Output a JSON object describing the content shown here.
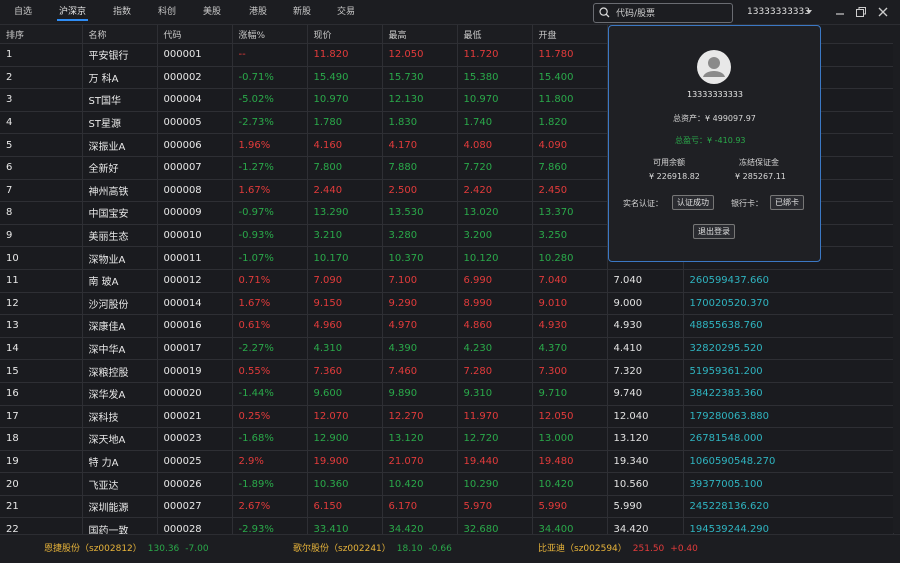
{
  "tabs": [
    "自选",
    "沪深京",
    "指数",
    "科创",
    "美股",
    "港股",
    "新股",
    "交易"
  ],
  "active_tab": 1,
  "search": {
    "placeholder": "代码/股票"
  },
  "user": {
    "account": "13333333333"
  },
  "columns": [
    "排序",
    "名称",
    "代码",
    "涨幅%",
    "现价",
    "最高",
    "最低",
    "开盘",
    "",
    ""
  ],
  "rows": [
    {
      "rank": "1",
      "name": "平安银行",
      "code": "000001",
      "chg": "--",
      "price": "11.820",
      "high": "12.050",
      "low": "11.720",
      "open": "11.780",
      "prev": "",
      "amount": "",
      "dir": "flat"
    },
    {
      "rank": "2",
      "name": "万 科A",
      "code": "000002",
      "chg": "-0.71%",
      "price": "15.490",
      "high": "15.730",
      "low": "15.380",
      "open": "15.400",
      "prev": "",
      "amount": "",
      "dir": "dn"
    },
    {
      "rank": "3",
      "name": "ST国华",
      "code": "000004",
      "chg": "-5.02%",
      "price": "10.970",
      "high": "12.130",
      "low": "10.970",
      "open": "11.800",
      "prev": "",
      "amount": "",
      "dir": "dn"
    },
    {
      "rank": "4",
      "name": "ST星源",
      "code": "000005",
      "chg": "-2.73%",
      "price": "1.780",
      "high": "1.830",
      "low": "1.740",
      "open": "1.820",
      "prev": "",
      "amount": "",
      "dir": "dn"
    },
    {
      "rank": "5",
      "name": "深振业A",
      "code": "000006",
      "chg": "1.96%",
      "price": "4.160",
      "high": "4.170",
      "low": "4.080",
      "open": "4.090",
      "prev": "",
      "amount": "",
      "dir": "up"
    },
    {
      "rank": "6",
      "name": "全新好",
      "code": "000007",
      "chg": "-1.27%",
      "price": "7.800",
      "high": "7.880",
      "low": "7.720",
      "open": "7.860",
      "prev": "",
      "amount": "",
      "dir": "dn"
    },
    {
      "rank": "7",
      "name": "神州高铁",
      "code": "000008",
      "chg": "1.67%",
      "price": "2.440",
      "high": "2.500",
      "low": "2.420",
      "open": "2.450",
      "prev": "",
      "amount": "",
      "dir": "up"
    },
    {
      "rank": "8",
      "name": "中国宝安",
      "code": "000009",
      "chg": "-0.97%",
      "price": "13.290",
      "high": "13.530",
      "low": "13.020",
      "open": "13.370",
      "prev": "",
      "amount": "",
      "dir": "dn"
    },
    {
      "rank": "9",
      "name": "美丽生态",
      "code": "000010",
      "chg": "-0.93%",
      "price": "3.210",
      "high": "3.280",
      "low": "3.200",
      "open": "3.250",
      "prev": "",
      "amount": "",
      "dir": "dn"
    },
    {
      "rank": "10",
      "name": "深物业A",
      "code": "000011",
      "chg": "-1.07%",
      "price": "10.170",
      "high": "10.370",
      "low": "10.120",
      "open": "10.280",
      "prev": "",
      "amount": "",
      "dir": "dn"
    },
    {
      "rank": "11",
      "name": "南 玻A",
      "code": "000012",
      "chg": "0.71%",
      "price": "7.090",
      "high": "7.100",
      "low": "6.990",
      "open": "7.040",
      "prev": "7.040",
      "amount": "260599437.660",
      "dir": "up"
    },
    {
      "rank": "12",
      "name": "沙河股份",
      "code": "000014",
      "chg": "1.67%",
      "price": "9.150",
      "high": "9.290",
      "low": "8.990",
      "open": "9.010",
      "prev": "9.000",
      "amount": "170020520.370",
      "dir": "up"
    },
    {
      "rank": "13",
      "name": "深康佳A",
      "code": "000016",
      "chg": "0.61%",
      "price": "4.960",
      "high": "4.970",
      "low": "4.860",
      "open": "4.930",
      "prev": "4.930",
      "amount": "48855638.760",
      "dir": "up"
    },
    {
      "rank": "14",
      "name": "深中华A",
      "code": "000017",
      "chg": "-2.27%",
      "price": "4.310",
      "high": "4.390",
      "low": "4.230",
      "open": "4.370",
      "prev": "4.410",
      "amount": "32820295.520",
      "dir": "dn"
    },
    {
      "rank": "15",
      "name": "深粮控股",
      "code": "000019",
      "chg": "0.55%",
      "price": "7.360",
      "high": "7.460",
      "low": "7.280",
      "open": "7.300",
      "prev": "7.320",
      "amount": "51959361.200",
      "dir": "up"
    },
    {
      "rank": "16",
      "name": "深华发A",
      "code": "000020",
      "chg": "-1.44%",
      "price": "9.600",
      "high": "9.890",
      "low": "9.310",
      "open": "9.710",
      "prev": "9.740",
      "amount": "38422383.360",
      "dir": "dn"
    },
    {
      "rank": "17",
      "name": "深科技",
      "code": "000021",
      "chg": "0.25%",
      "price": "12.070",
      "high": "12.270",
      "low": "11.970",
      "open": "12.050",
      "prev": "12.040",
      "amount": "179280063.880",
      "dir": "up"
    },
    {
      "rank": "18",
      "name": "深天地A",
      "code": "000023",
      "chg": "-1.68%",
      "price": "12.900",
      "high": "13.120",
      "low": "12.720",
      "open": "13.000",
      "prev": "13.120",
      "amount": "26781548.000",
      "dir": "dn"
    },
    {
      "rank": "19",
      "name": "特 力A",
      "code": "000025",
      "chg": "2.9%",
      "price": "19.900",
      "high": "21.070",
      "low": "19.440",
      "open": "19.480",
      "prev": "19.340",
      "amount": "1060590548.270",
      "dir": "up"
    },
    {
      "rank": "20",
      "name": "飞亚达",
      "code": "000026",
      "chg": "-1.89%",
      "price": "10.360",
      "high": "10.420",
      "low": "10.290",
      "open": "10.420",
      "prev": "10.560",
      "amount": "39377005.100",
      "dir": "dn"
    },
    {
      "rank": "21",
      "name": "深圳能源",
      "code": "000027",
      "chg": "2.67%",
      "price": "6.150",
      "high": "6.170",
      "low": "5.970",
      "open": "5.990",
      "prev": "5.990",
      "amount": "245228136.620",
      "dir": "up"
    },
    {
      "rank": "22",
      "name": "国药一致",
      "code": "000028",
      "chg": "-2.93%",
      "price": "33.410",
      "high": "34.420",
      "low": "32.680",
      "open": "34.400",
      "prev": "34.420",
      "amount": "194539244.290",
      "dir": "dn"
    }
  ],
  "ticker": [
    {
      "name": "恩捷股份",
      "code": "（sz002812）",
      "price": "130.36",
      "change": "-7.00",
      "dir": "dn"
    },
    {
      "name": "歌尔股份",
      "code": "（sz002241）",
      "price": "18.10",
      "change": "-0.66",
      "dir": "dn"
    },
    {
      "name": "比亚迪",
      "code": "（sz002594）",
      "price": "251.50",
      "change": "+0.40",
      "dir": "up"
    }
  ],
  "account_popup": {
    "phone": "13333333333",
    "total_assets_label": "总资产：",
    "total_assets_value": "¥ 499097.97",
    "total_pl_label": "总盈亏：",
    "total_pl_value": "¥ -410.93",
    "available_label": "可用余额",
    "available_value": "¥ 226918.82",
    "frozen_label": "冻结保证金",
    "frozen_value": "¥ 285267.11",
    "realname_label": "实名认证：",
    "realname_button": "认证成功",
    "bankcard_label": "银行卡：",
    "bankcard_button": "已绑卡",
    "logout_button": "退出登录"
  },
  "colors": {
    "up": "#e23b3b",
    "down": "#2aa94a",
    "amount": "#2fb4c0",
    "accent": "#2f8df5",
    "popup_border": "#3b78c4"
  }
}
